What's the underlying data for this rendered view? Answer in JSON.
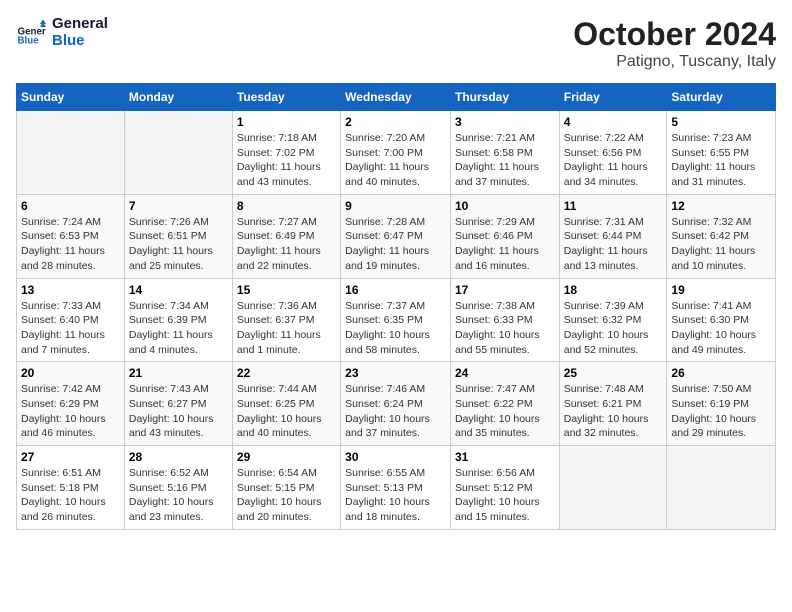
{
  "header": {
    "logo_line1": "General",
    "logo_line2": "Blue",
    "title": "October 2024",
    "subtitle": "Patigno, Tuscany, Italy"
  },
  "columns": [
    "Sunday",
    "Monday",
    "Tuesday",
    "Wednesday",
    "Thursday",
    "Friday",
    "Saturday"
  ],
  "weeks": [
    [
      {
        "day": "",
        "info": ""
      },
      {
        "day": "",
        "info": ""
      },
      {
        "day": "1",
        "info": "Sunrise: 7:18 AM\nSunset: 7:02 PM\nDaylight: 11 hours and 43 minutes."
      },
      {
        "day": "2",
        "info": "Sunrise: 7:20 AM\nSunset: 7:00 PM\nDaylight: 11 hours and 40 minutes."
      },
      {
        "day": "3",
        "info": "Sunrise: 7:21 AM\nSunset: 6:58 PM\nDaylight: 11 hours and 37 minutes."
      },
      {
        "day": "4",
        "info": "Sunrise: 7:22 AM\nSunset: 6:56 PM\nDaylight: 11 hours and 34 minutes."
      },
      {
        "day": "5",
        "info": "Sunrise: 7:23 AM\nSunset: 6:55 PM\nDaylight: 11 hours and 31 minutes."
      }
    ],
    [
      {
        "day": "6",
        "info": "Sunrise: 7:24 AM\nSunset: 6:53 PM\nDaylight: 11 hours and 28 minutes."
      },
      {
        "day": "7",
        "info": "Sunrise: 7:26 AM\nSunset: 6:51 PM\nDaylight: 11 hours and 25 minutes."
      },
      {
        "day": "8",
        "info": "Sunrise: 7:27 AM\nSunset: 6:49 PM\nDaylight: 11 hours and 22 minutes."
      },
      {
        "day": "9",
        "info": "Sunrise: 7:28 AM\nSunset: 6:47 PM\nDaylight: 11 hours and 19 minutes."
      },
      {
        "day": "10",
        "info": "Sunrise: 7:29 AM\nSunset: 6:46 PM\nDaylight: 11 hours and 16 minutes."
      },
      {
        "day": "11",
        "info": "Sunrise: 7:31 AM\nSunset: 6:44 PM\nDaylight: 11 hours and 13 minutes."
      },
      {
        "day": "12",
        "info": "Sunrise: 7:32 AM\nSunset: 6:42 PM\nDaylight: 11 hours and 10 minutes."
      }
    ],
    [
      {
        "day": "13",
        "info": "Sunrise: 7:33 AM\nSunset: 6:40 PM\nDaylight: 11 hours and 7 minutes."
      },
      {
        "day": "14",
        "info": "Sunrise: 7:34 AM\nSunset: 6:39 PM\nDaylight: 11 hours and 4 minutes."
      },
      {
        "day": "15",
        "info": "Sunrise: 7:36 AM\nSunset: 6:37 PM\nDaylight: 11 hours and 1 minute."
      },
      {
        "day": "16",
        "info": "Sunrise: 7:37 AM\nSunset: 6:35 PM\nDaylight: 10 hours and 58 minutes."
      },
      {
        "day": "17",
        "info": "Sunrise: 7:38 AM\nSunset: 6:33 PM\nDaylight: 10 hours and 55 minutes."
      },
      {
        "day": "18",
        "info": "Sunrise: 7:39 AM\nSunset: 6:32 PM\nDaylight: 10 hours and 52 minutes."
      },
      {
        "day": "19",
        "info": "Sunrise: 7:41 AM\nSunset: 6:30 PM\nDaylight: 10 hours and 49 minutes."
      }
    ],
    [
      {
        "day": "20",
        "info": "Sunrise: 7:42 AM\nSunset: 6:29 PM\nDaylight: 10 hours and 46 minutes."
      },
      {
        "day": "21",
        "info": "Sunrise: 7:43 AM\nSunset: 6:27 PM\nDaylight: 10 hours and 43 minutes."
      },
      {
        "day": "22",
        "info": "Sunrise: 7:44 AM\nSunset: 6:25 PM\nDaylight: 10 hours and 40 minutes."
      },
      {
        "day": "23",
        "info": "Sunrise: 7:46 AM\nSunset: 6:24 PM\nDaylight: 10 hours and 37 minutes."
      },
      {
        "day": "24",
        "info": "Sunrise: 7:47 AM\nSunset: 6:22 PM\nDaylight: 10 hours and 35 minutes."
      },
      {
        "day": "25",
        "info": "Sunrise: 7:48 AM\nSunset: 6:21 PM\nDaylight: 10 hours and 32 minutes."
      },
      {
        "day": "26",
        "info": "Sunrise: 7:50 AM\nSunset: 6:19 PM\nDaylight: 10 hours and 29 minutes."
      }
    ],
    [
      {
        "day": "27",
        "info": "Sunrise: 6:51 AM\nSunset: 5:18 PM\nDaylight: 10 hours and 26 minutes."
      },
      {
        "day": "28",
        "info": "Sunrise: 6:52 AM\nSunset: 5:16 PM\nDaylight: 10 hours and 23 minutes."
      },
      {
        "day": "29",
        "info": "Sunrise: 6:54 AM\nSunset: 5:15 PM\nDaylight: 10 hours and 20 minutes."
      },
      {
        "day": "30",
        "info": "Sunrise: 6:55 AM\nSunset: 5:13 PM\nDaylight: 10 hours and 18 minutes."
      },
      {
        "day": "31",
        "info": "Sunrise: 6:56 AM\nSunset: 5:12 PM\nDaylight: 10 hours and 15 minutes."
      },
      {
        "day": "",
        "info": ""
      },
      {
        "day": "",
        "info": ""
      }
    ]
  ]
}
